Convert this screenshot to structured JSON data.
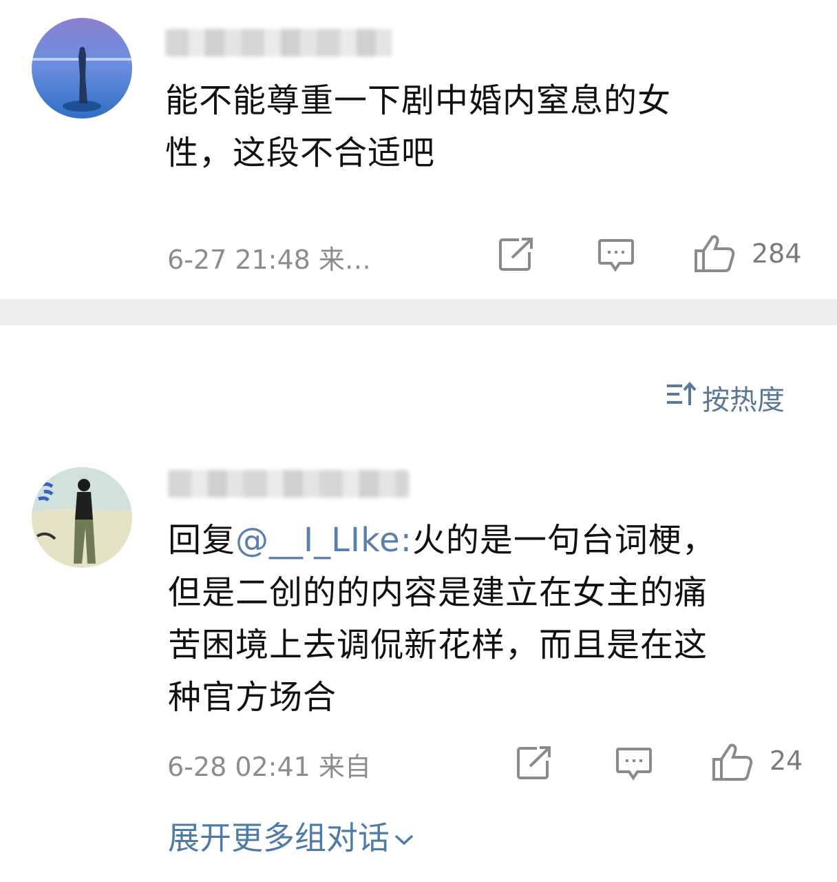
{
  "comment1": {
    "username": "",
    "text_line1": "能不能尊重一下剧中婚内窒息的女",
    "text_line2": "性，这段不合适吧",
    "timestamp": "6-27 21:48 来…",
    "like_count": "284",
    "icons": {
      "share": "share-icon",
      "reply": "comment-icon",
      "like": "thumbs-up-icon"
    }
  },
  "sort": {
    "label": "按热度",
    "icon": "sort-icon"
  },
  "comment2": {
    "username": "",
    "reply_prefix": "回复",
    "reply_mention": "@__I_LIke:",
    "text_line1_rest": "火的是一句台词梗，",
    "text_line2": "但是二创的的内容是建立在女主的痛",
    "text_line3": "苦困境上去调侃新花样，而且是在这",
    "text_line4": "种官方场合",
    "timestamp": "6-28 02:41 来自",
    "like_count": "24",
    "icons": {
      "share": "share-icon",
      "reply": "comment-icon",
      "like": "thumbs-up-icon"
    }
  },
  "expand": {
    "label": "展开更多组对话",
    "icon": "chevron-down-icon"
  },
  "colors": {
    "link": "#4d7aa6",
    "meta": "#8c8c8c",
    "band": "#eeeeee"
  }
}
